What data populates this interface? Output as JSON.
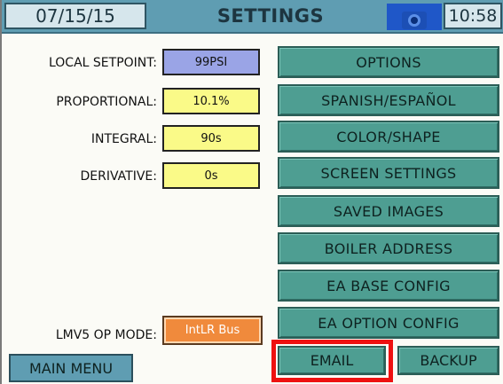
{
  "header": {
    "date": "07/15/15",
    "title": "SETTINGS",
    "time": "10:58",
    "camera_icon": "camera-icon"
  },
  "params": [
    {
      "label": "LOCAL SETPOINT:",
      "value": "99PSI",
      "color": "#9aa4e6"
    },
    {
      "label": "PROPORTIONAL:",
      "value": "10.1%",
      "color": "#fafa88"
    },
    {
      "label": "INTEGRAL:",
      "value": "90s",
      "color": "#fafa88"
    },
    {
      "label": "DERIVATIVE:",
      "value": "0s",
      "color": "#fafa88"
    }
  ],
  "op_mode": {
    "label": "LMV5 OP MODE:",
    "value": "IntLR Bus",
    "color": "#f08a3c"
  },
  "menu": [
    "OPTIONS",
    "SPANISH/ESPAÑOL",
    "COLOR/SHAPE",
    "SCREEN SETTINGS",
    "SAVED IMAGES",
    "BOILER ADDRESS",
    "EA BASE CONFIG",
    "EA OPTION CONFIG"
  ],
  "bottom": {
    "email": "EMAIL",
    "backup": "BACKUP",
    "main_menu": "MAIN MENU",
    "highlight_color": "#ee1111"
  }
}
